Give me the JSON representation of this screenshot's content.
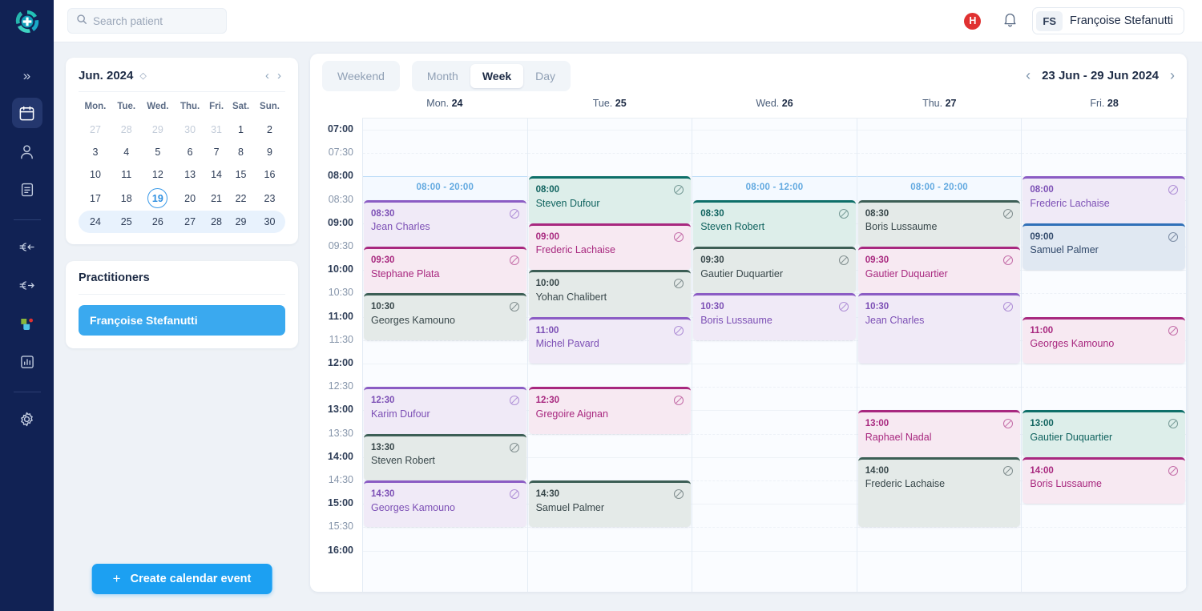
{
  "brand": {
    "accent": "#1ca0f2",
    "rail_bg": "#112254"
  },
  "topbar": {
    "search_placeholder": "Search patient",
    "search_value": "",
    "help_label": "H",
    "user": {
      "initials": "FS",
      "name": "Françoise Stefanutti"
    }
  },
  "rail": {
    "collapse_label": "»",
    "items": [
      {
        "icon": "calendar-icon",
        "name": "calendar",
        "active": true
      },
      {
        "icon": "user-icon",
        "name": "patients",
        "active": false
      },
      {
        "icon": "document-icon",
        "name": "documents",
        "active": false
      },
      {
        "icon": "euro-in-icon",
        "name": "payments-in",
        "active": false
      },
      {
        "icon": "euro-out-icon",
        "name": "payments-out",
        "active": false
      },
      {
        "icon": "apps-icon",
        "name": "apps",
        "active": false
      },
      {
        "icon": "chart-icon",
        "name": "statistics",
        "active": false
      },
      {
        "icon": "gear-icon",
        "name": "settings",
        "active": false
      }
    ]
  },
  "minicalendar": {
    "title": "Jun. 2024",
    "prev_label": "‹",
    "next_label": "›",
    "weekdays": [
      "Mon.",
      "Tue.",
      "Wed.",
      "Thu.",
      "Fri.",
      "Sat.",
      "Sun."
    ],
    "weeks": [
      [
        {
          "d": "27",
          "muted": true
        },
        {
          "d": "28",
          "muted": true
        },
        {
          "d": "29",
          "muted": true
        },
        {
          "d": "30",
          "muted": true
        },
        {
          "d": "31",
          "muted": true
        },
        {
          "d": "1"
        },
        {
          "d": "2"
        }
      ],
      [
        {
          "d": "3"
        },
        {
          "d": "4"
        },
        {
          "d": "5"
        },
        {
          "d": "6"
        },
        {
          "d": "7"
        },
        {
          "d": "8"
        },
        {
          "d": "9"
        }
      ],
      [
        {
          "d": "10"
        },
        {
          "d": "11"
        },
        {
          "d": "12"
        },
        {
          "d": "13"
        },
        {
          "d": "14"
        },
        {
          "d": "15"
        },
        {
          "d": "16"
        }
      ],
      [
        {
          "d": "17"
        },
        {
          "d": "18"
        },
        {
          "d": "19",
          "today": true
        },
        {
          "d": "20"
        },
        {
          "d": "21"
        },
        {
          "d": "22"
        },
        {
          "d": "23"
        }
      ],
      [
        {
          "d": "24"
        },
        {
          "d": "25"
        },
        {
          "d": "26"
        },
        {
          "d": "27"
        },
        {
          "d": "28"
        },
        {
          "d": "29"
        },
        {
          "d": "30"
        }
      ]
    ],
    "selected_week_index": 4
  },
  "practitioners": {
    "title": "Practitioners",
    "items": [
      {
        "name": "Françoise Stefanutti",
        "selected": true
      }
    ]
  },
  "create_button": {
    "plus": "+",
    "label": "Create calendar event"
  },
  "calendar": {
    "weekend_toggle": "Weekend",
    "views": [
      {
        "label": "Month",
        "active": false
      },
      {
        "label": "Week",
        "active": true
      },
      {
        "label": "Day",
        "active": false
      }
    ],
    "range_label": "23 Jun - 29 Jun 2024",
    "prev_label": "‹",
    "next_label": "›",
    "time_start": "07:00",
    "time_end": "16:00",
    "time_labels": [
      "07:00",
      "07:30",
      "08:00",
      "08:30",
      "09:00",
      "09:30",
      "10:00",
      "10:30",
      "11:00",
      "11:30",
      "12:00",
      "12:30",
      "13:00",
      "13:30",
      "14:00",
      "14:30",
      "15:00",
      "15:30",
      "16:00"
    ],
    "days": [
      {
        "weekday": "Mon.",
        "date": "24",
        "availability": {
          "label": "08:00 - 20:00",
          "start": "08:00",
          "end": "08:30"
        },
        "events": [
          {
            "time": "08:30",
            "name": "Jean Charles",
            "start": "08:30",
            "end": "09:30",
            "color": "purple",
            "status_icon": "blocked-icon"
          },
          {
            "time": "09:30",
            "name": "Stephane Plata",
            "start": "09:30",
            "end": "10:30",
            "color": "magenta",
            "status_icon": "blocked-icon"
          },
          {
            "time": "10:30",
            "name": "Georges Kamouno",
            "start": "10:30",
            "end": "11:30",
            "color": "slate",
            "status_icon": "blocked-icon"
          },
          {
            "time": "12:30",
            "name": "Karim Dufour",
            "start": "12:30",
            "end": "13:30",
            "color": "purple",
            "status_icon": "blocked-icon"
          },
          {
            "time": "13:30",
            "name": "Steven Robert",
            "start": "13:30",
            "end": "14:30",
            "color": "slate",
            "status_icon": "blocked-icon"
          },
          {
            "time": "14:30",
            "name": "Georges Kamouno",
            "start": "14:30",
            "end": "15:30",
            "color": "purple",
            "status_icon": "blocked-icon"
          }
        ]
      },
      {
        "weekday": "Tue.",
        "date": "25",
        "availability": null,
        "events": [
          {
            "time": "08:00",
            "name": "Steven Dufour",
            "start": "08:00",
            "end": "09:00",
            "color": "teal",
            "status_icon": "blocked-icon"
          },
          {
            "time": "09:00",
            "name": "Frederic Lachaise",
            "start": "09:00",
            "end": "10:00",
            "color": "magenta",
            "status_icon": "blocked-icon"
          },
          {
            "time": "10:00",
            "name": "Yohan Chalibert",
            "start": "10:00",
            "end": "11:00",
            "color": "slate",
            "status_icon": "blocked-icon"
          },
          {
            "time": "11:00",
            "name": "Michel Pavard",
            "start": "11:00",
            "end": "12:00",
            "color": "purple",
            "status_icon": "blocked-icon"
          },
          {
            "time": "12:30",
            "name": "Gregoire Aignan",
            "start": "12:30",
            "end": "13:30",
            "color": "magenta",
            "status_icon": "blocked-icon"
          },
          {
            "time": "14:30",
            "name": "Samuel Palmer",
            "start": "14:30",
            "end": "15:30",
            "color": "slate",
            "status_icon": "blocked-icon"
          }
        ]
      },
      {
        "weekday": "Wed.",
        "date": "26",
        "availability": {
          "label": "08:00 - 12:00",
          "start": "08:00",
          "end": "08:30"
        },
        "events": [
          {
            "time": "08:30",
            "name": "Steven Robert",
            "start": "08:30",
            "end": "09:30",
            "color": "teal",
            "status_icon": "blocked-icon"
          },
          {
            "time": "09:30",
            "name": "Gautier Duquartier",
            "start": "09:30",
            "end": "10:30",
            "color": "slate",
            "status_icon": "blocked-icon"
          },
          {
            "time": "10:30",
            "name": "Boris Lussaume",
            "start": "10:30",
            "end": "11:30",
            "color": "purple",
            "status_icon": "blocked-icon"
          }
        ]
      },
      {
        "weekday": "Thu.",
        "date": "27",
        "availability": {
          "label": "08:00 - 20:00",
          "start": "08:00",
          "end": "08:30"
        },
        "events": [
          {
            "time": "08:30",
            "name": "Boris Lussaume",
            "start": "08:30",
            "end": "09:30",
            "color": "slate",
            "status_icon": "blocked-icon"
          },
          {
            "time": "09:30",
            "name": "Gautier Duquartier",
            "start": "09:30",
            "end": "10:30",
            "color": "magenta",
            "status_icon": "blocked-icon"
          },
          {
            "time": "10:30",
            "name": "Jean Charles",
            "start": "10:30",
            "end": "12:00",
            "color": "purple",
            "status_icon": "blocked-icon"
          },
          {
            "time": "13:00",
            "name": "Raphael Nadal",
            "start": "13:00",
            "end": "14:00",
            "color": "magenta",
            "status_icon": "blocked-icon"
          },
          {
            "time": "14:00",
            "name": "Frederic Lachaise",
            "start": "14:00",
            "end": "15:30",
            "color": "slate",
            "status_icon": "blocked-icon"
          }
        ]
      },
      {
        "weekday": "Fri.",
        "date": "28",
        "availability": null,
        "events": [
          {
            "time": "08:00",
            "name": "Frederic Lachaise",
            "start": "08:00",
            "end": "09:00",
            "color": "purple",
            "status_icon": "blocked-icon"
          },
          {
            "time": "09:00",
            "name": "Samuel Palmer",
            "start": "09:00",
            "end": "10:00",
            "color": "blue",
            "status_icon": "blocked-icon"
          },
          {
            "time": "11:00",
            "name": "Georges Kamouno",
            "start": "11:00",
            "end": "12:00",
            "color": "magenta",
            "status_icon": "blocked-icon"
          },
          {
            "time": "13:00",
            "name": "Gautier Duquartier",
            "start": "13:00",
            "end": "14:00",
            "color": "teal",
            "status_icon": "blocked-icon"
          },
          {
            "time": "14:00",
            "name": "Boris Lussaume",
            "start": "14:00",
            "end": "15:00",
            "color": "magenta",
            "status_icon": "blocked-icon"
          }
        ]
      }
    ]
  }
}
